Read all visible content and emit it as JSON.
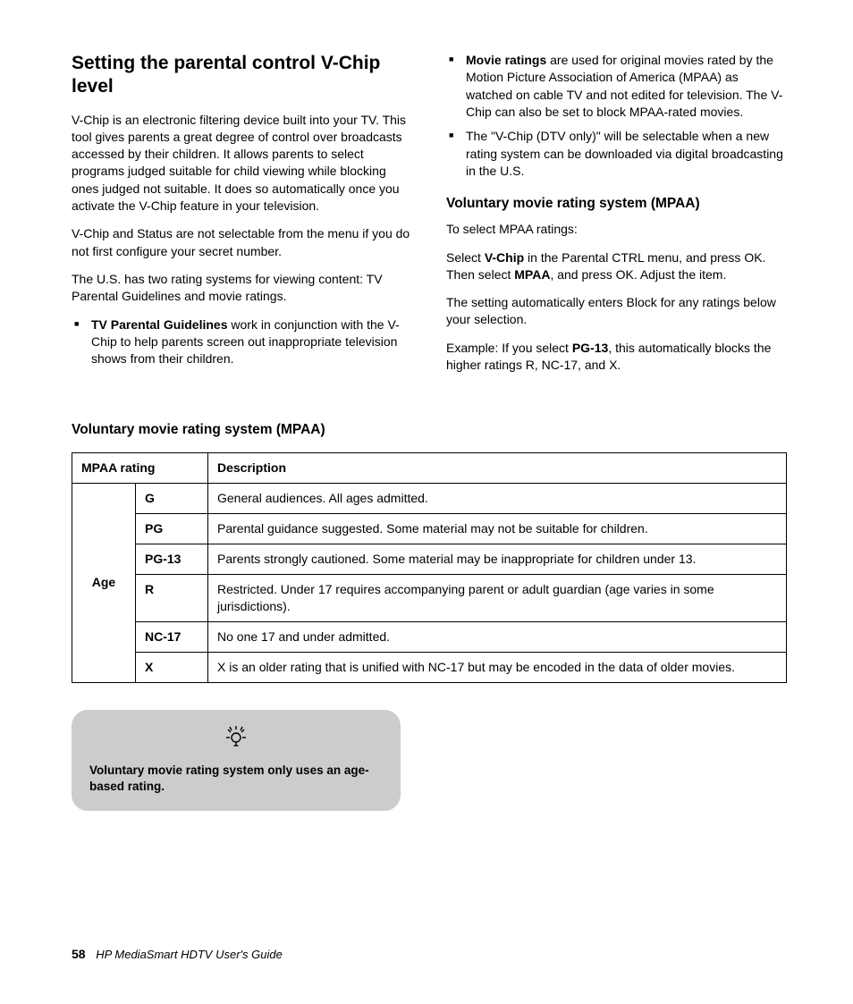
{
  "header": {
    "title": "Setting the parental control V-Chip level"
  },
  "leftCol": {
    "p1": "V-Chip is an electronic filtering device built into your TV. This tool gives parents a great degree of control over broadcasts accessed by their children. It allows parents to select programs judged suitable for child viewing while blocking ones judged not suitable. It does so automatically once you activate the V-Chip feature in your television.",
    "p2": "V-Chip and Status are not selectable from the menu if you do not first configure your secret number.",
    "p3": "The U.S. has two rating systems for viewing content: TV Parental Guidelines and movie ratings.",
    "bullet1_bold": "TV Parental Guidelines",
    "bullet1_rest": " work in conjunction with the V-Chip to help parents screen out inappropriate television shows from their children."
  },
  "rightCol": {
    "bullet1_bold": "Movie ratings",
    "bullet1_rest": " are used for original movies rated by the Motion Picture Association of America (MPAA) as watched on cable TV and not edited for television. The V-Chip can also be set to block MPAA-rated movies.",
    "bullet2": "The \"V-Chip (DTV only)\" will be selectable when a new rating system can be downloaded via digital broadcasting in the U.S.",
    "sub_title": "Voluntary movie rating system (MPAA)",
    "p1": "To select MPAA ratings:",
    "p2_a": "Select ",
    "p2_b": "V-Chip",
    "p2_c": " in the Parental CTRL menu, and press OK. Then select ",
    "p2_d": "MPAA",
    "p2_e": ", and press OK. Adjust the item.",
    "p3": "The setting automatically enters Block for any ratings below your selection.",
    "p4_a": "Example: If you select ",
    "p4_b": "PG-13",
    "p4_c": ", this automatically blocks the higher ratings R, NC-17, and X."
  },
  "tableSection": {
    "heading": "Voluntary movie rating system (MPAA)",
    "th1": "MPAA rating",
    "th2": "Description",
    "ageLabel": "Age",
    "rows": [
      {
        "rating": "G",
        "desc": "General audiences. All ages admitted."
      },
      {
        "rating": "PG",
        "desc": "Parental guidance suggested. Some material may not be suitable for children."
      },
      {
        "rating": "PG-13",
        "desc": "Parents strongly cautioned. Some material may be inappropriate for children under 13."
      },
      {
        "rating": "R",
        "desc": "Restricted. Under 17 requires accompanying parent or adult guardian (age varies in some jurisdictions)."
      },
      {
        "rating": "NC-17",
        "desc": "No one 17 and under admitted."
      },
      {
        "rating": "X",
        "desc": "X is an older rating that is unified with NC-17 but may be encoded in the data of older movies."
      }
    ]
  },
  "tip": {
    "text": "Voluntary movie rating system only uses an age-based rating."
  },
  "footer": {
    "page": "58",
    "title": "HP MediaSmart HDTV User's Guide"
  }
}
